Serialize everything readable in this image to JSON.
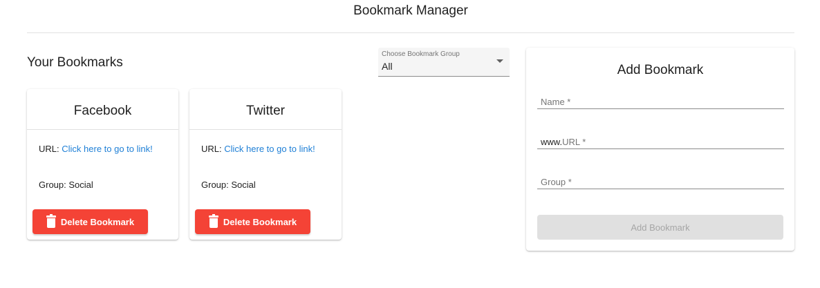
{
  "header": {
    "title": "Bookmark Manager"
  },
  "bookmarks_section": {
    "title": "Your Bookmarks"
  },
  "group_select": {
    "label": "Choose Bookmark Group",
    "value": "All"
  },
  "bookmarks": [
    {
      "name": "Facebook",
      "url_label": "URL:",
      "url_link": "Click here to go to link!",
      "group_text": "Group: Social",
      "delete_label": "Delete Bookmark"
    },
    {
      "name": "Twitter",
      "url_label": "URL:",
      "url_link": "Click here to go to link!",
      "group_text": "Group: Social",
      "delete_label": "Delete Bookmark"
    }
  ],
  "add_form": {
    "title": "Add Bookmark",
    "name_placeholder": "Name *",
    "url_prefix": "www.",
    "url_placeholder": "URL *",
    "group_placeholder": "Group *",
    "submit_label": "Add Bookmark"
  },
  "colors": {
    "danger": "#f44336",
    "link": "#1e7fd6",
    "disabled_bg": "#e0e0e0"
  },
  "icons": {
    "delete": "trash-icon",
    "select": "caret-down-icon"
  }
}
